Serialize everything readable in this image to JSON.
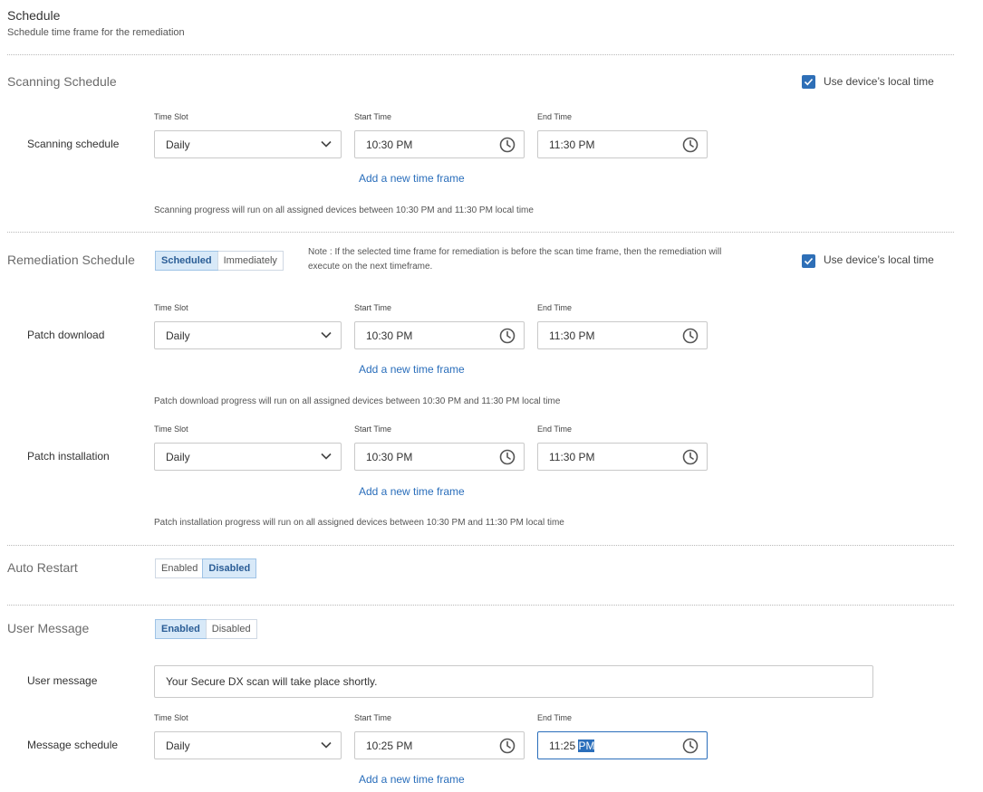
{
  "header": {
    "title": "Schedule",
    "subtitle": "Schedule time frame for the remediation"
  },
  "local_time_label": "Use device’s local time",
  "labels": {
    "time_slot": "Time Slot",
    "start_time": "Start Time",
    "end_time": "End Time",
    "add_frame": "Add a new time frame"
  },
  "scanning": {
    "title": "Scanning Schedule",
    "row_label": "Scanning schedule",
    "slot": "Daily",
    "start": "10:30 PM",
    "end": "11:30 PM",
    "note": "Scanning progress will run on all assigned devices between 10:30 PM and 11:30 PM local time"
  },
  "remediation": {
    "title": "Remediation Schedule",
    "toggle": [
      "Scheduled",
      "Immediately"
    ],
    "note_line1": "Note : If the selected time frame for remediation is before the scan time frame, then the remediation will",
    "note_line2": "execute on the next timeframe.",
    "download": {
      "row_label": "Patch download",
      "slot": "Daily",
      "start": "10:30 PM",
      "end": "11:30 PM",
      "note": "Patch download progress will run on all assigned devices between 10:30 PM and 11:30 PM local time"
    },
    "installation": {
      "row_label": "Patch installation",
      "slot": "Daily",
      "start": "10:30 PM",
      "end": "11:30 PM",
      "note": "Patch installation progress will run on all assigned devices between 10:30 PM and 11:30 PM local time"
    }
  },
  "auto_restart": {
    "title": "Auto Restart",
    "toggle": [
      "Enabled",
      "Disabled"
    ]
  },
  "user_message": {
    "title": "User Message",
    "toggle": [
      "Enabled",
      "Disabled"
    ],
    "message_label": "User message",
    "message_value": "Your Secure DX scan will take place shortly.",
    "schedule_label": "Message schedule",
    "slot": "Daily",
    "start": "10:25 PM",
    "end_prefix": "11:25 ",
    "end_selected": "PM"
  },
  "colors": {
    "accent": "#2a6ebb",
    "checkbox": "#2e6fb7",
    "toggle_active_bg": "#d8e9f8"
  }
}
